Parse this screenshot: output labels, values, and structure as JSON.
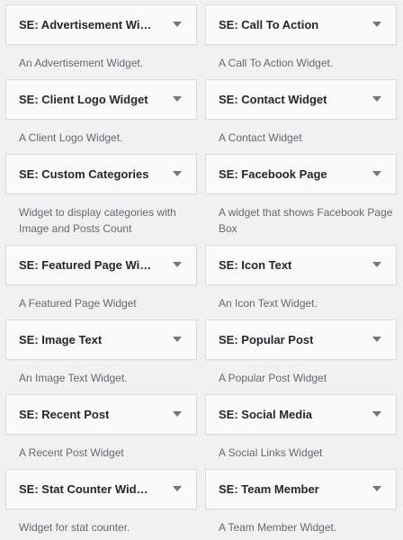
{
  "widgets": [
    {
      "title": "SE: Advertisement Widget",
      "description": "An Advertisement Widget."
    },
    {
      "title": "SE: Call To Action",
      "description": "A Call To Action Widget."
    },
    {
      "title": "SE: Client Logo Widget",
      "description": "A Client Logo Widget."
    },
    {
      "title": "SE: Contact Widget",
      "description": "A Contact Widget"
    },
    {
      "title": "SE: Custom Categories",
      "description": "Widget to display categories with Image and Posts Count"
    },
    {
      "title": "SE: Facebook Page",
      "description": "A widget that shows Facebook Page Box"
    },
    {
      "title": "SE: Featured Page Widget",
      "description": "A Featured Page Widget"
    },
    {
      "title": "SE: Icon Text",
      "description": "An Icon Text Widget."
    },
    {
      "title": "SE: Image Text",
      "description": "An Image Text Widget."
    },
    {
      "title": "SE: Popular Post",
      "description": "A Popular Post Widget"
    },
    {
      "title": "SE: Recent Post",
      "description": "A Recent Post Widget"
    },
    {
      "title": "SE: Social Media",
      "description": "A Social Links Widget"
    },
    {
      "title": "SE: Stat Counter Widget",
      "description": "Widget for stat counter."
    },
    {
      "title": "SE: Team Member",
      "description": "A Team Member Widget."
    }
  ],
  "icons": {
    "toggle": "chevron-down-icon"
  },
  "colors": {
    "background": "#f1f1f1",
    "title_bg": "#fafafa",
    "border": "#dcdcde",
    "title_text": "#23282d",
    "desc_text": "#646970"
  }
}
